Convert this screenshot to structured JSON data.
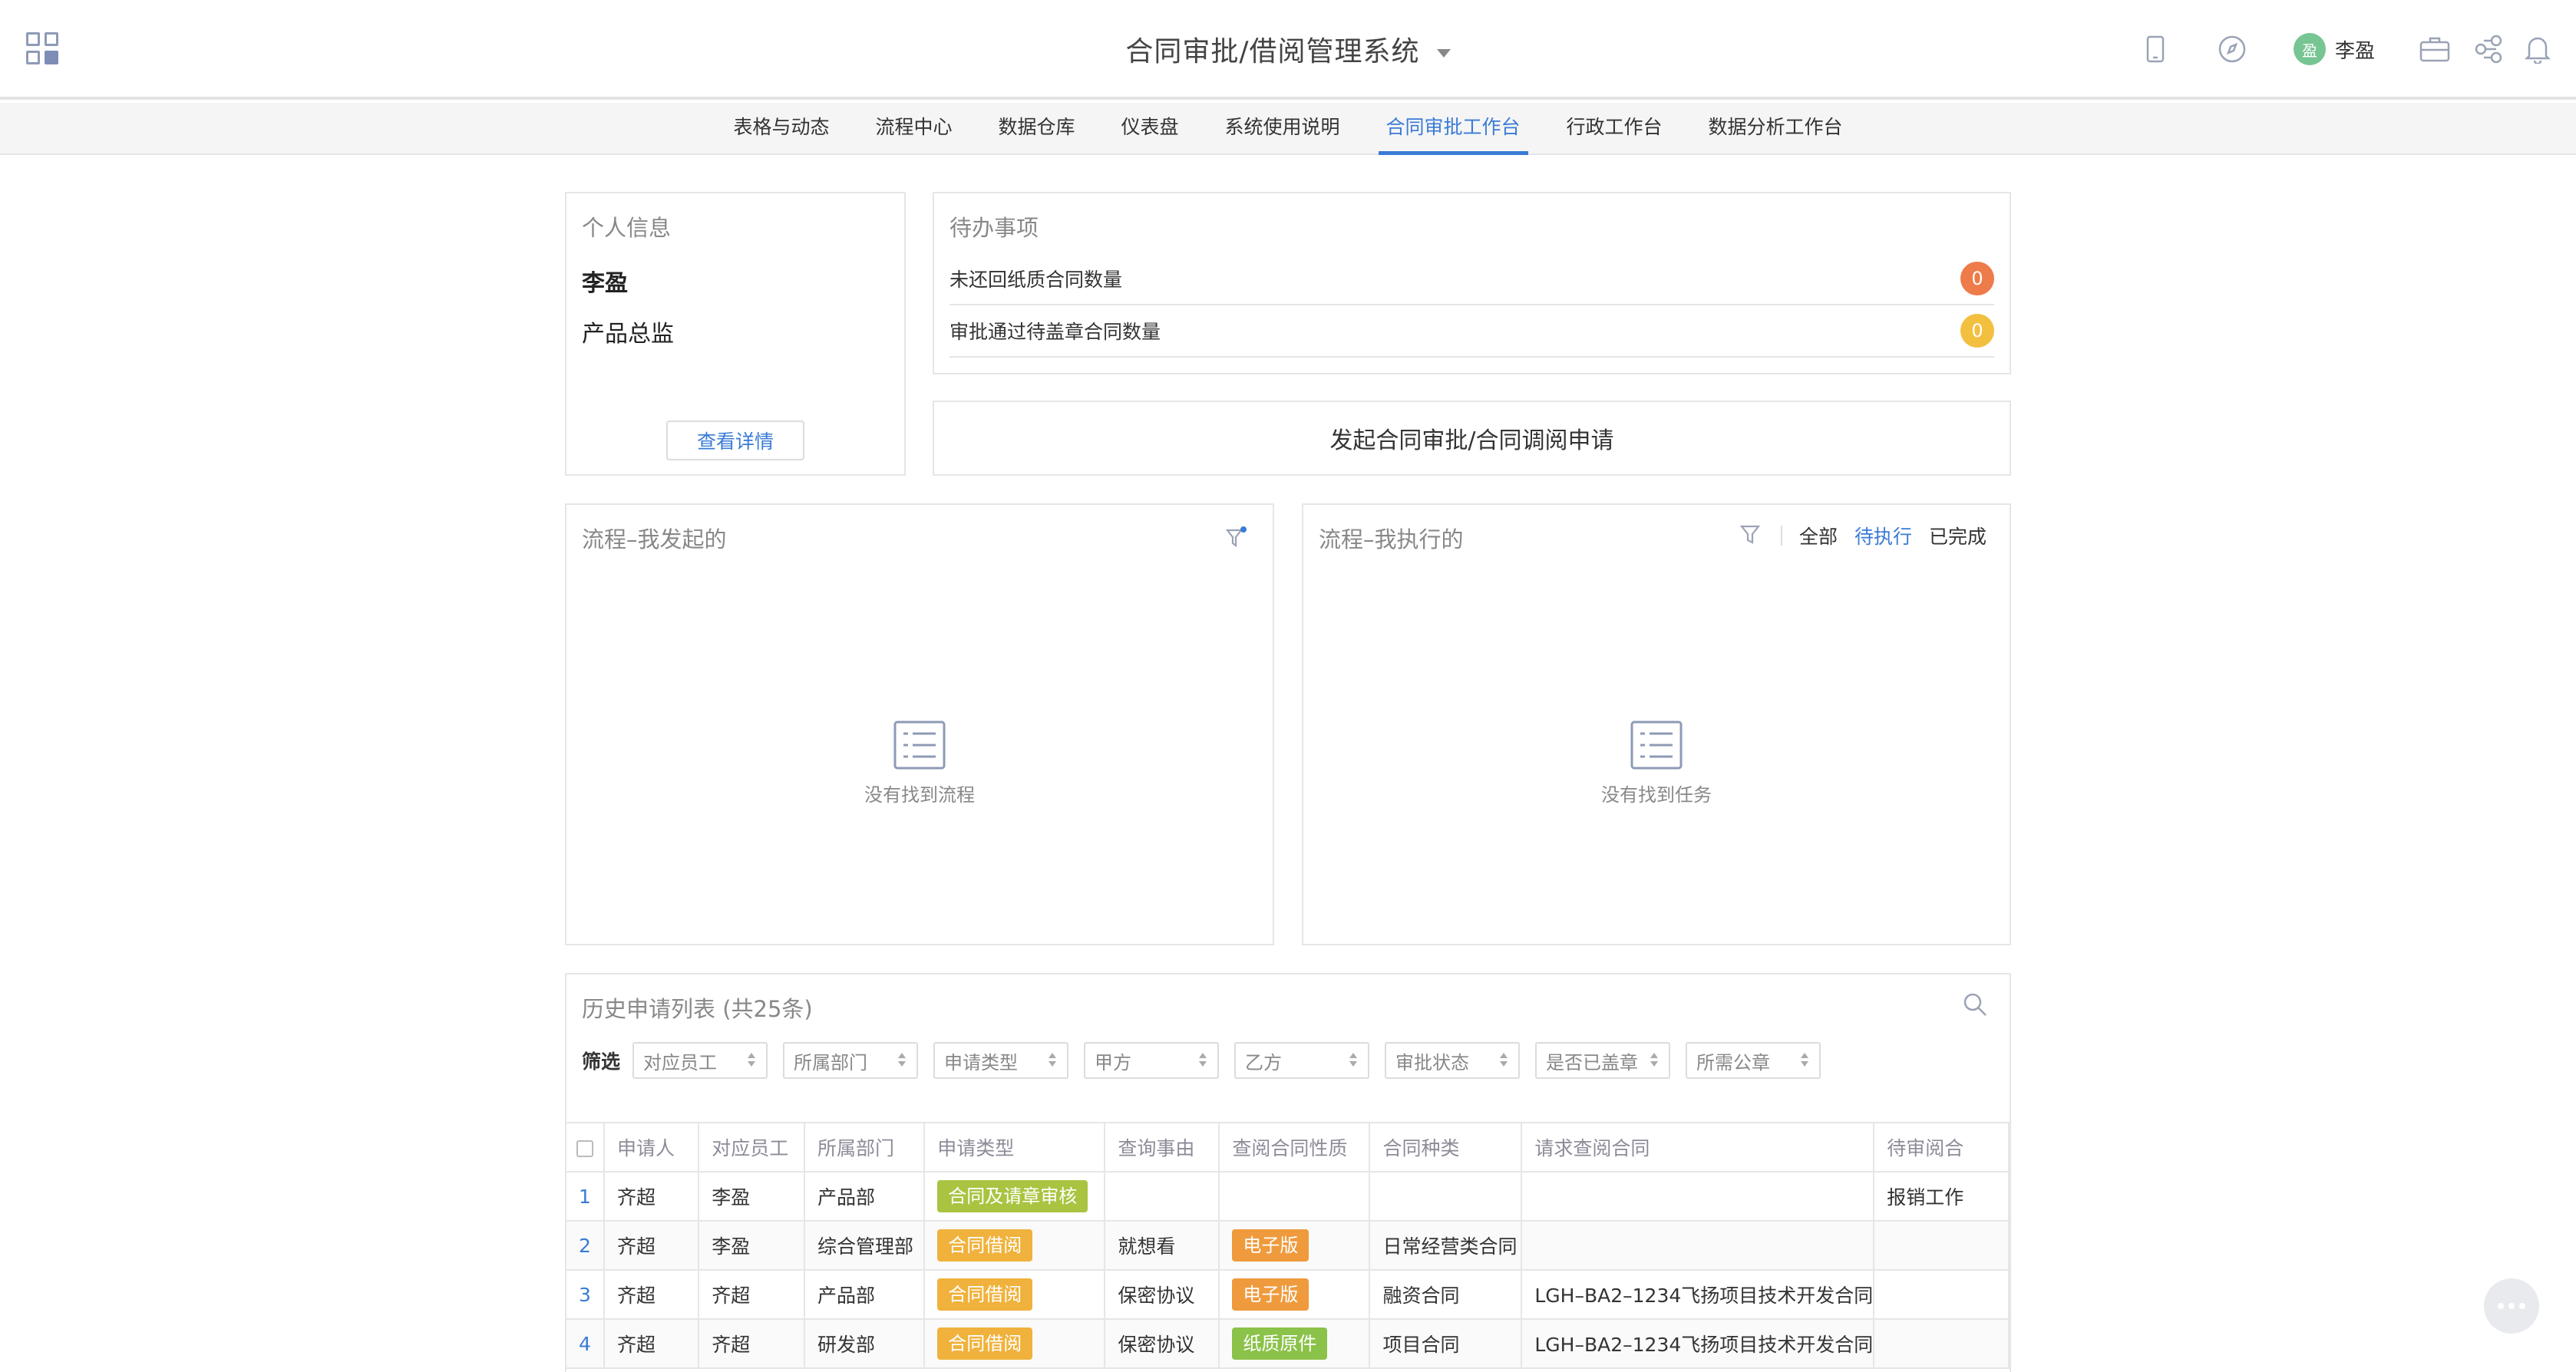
{
  "header": {
    "app_title": "合同审批/借阅管理系统",
    "user_name": "李盈",
    "user_avatar_char": "盈"
  },
  "nav": {
    "items": [
      {
        "label": "表格与动态"
      },
      {
        "label": "流程中心"
      },
      {
        "label": "数据仓库"
      },
      {
        "label": "仪表盘"
      },
      {
        "label": "系统使用说明"
      },
      {
        "label": "合同审批工作台",
        "active": true
      },
      {
        "label": "行政工作台"
      },
      {
        "label": "数据分析工作台"
      }
    ]
  },
  "personal": {
    "title": "个人信息",
    "name": "李盈",
    "role": "产品总监",
    "detail_button": "查看详情"
  },
  "todo": {
    "title": "待办事项",
    "items": [
      {
        "label": "未还回纸质合同数量",
        "count": "0",
        "color": "#ee7b4a"
      },
      {
        "label": "审批通过待盖章合同数量",
        "count": "0",
        "color": "#f3bf3f"
      }
    ]
  },
  "start_request_button": "发起合同审批/合同调阅申请",
  "flow_started": {
    "title": "流程–我发起的",
    "empty_text": "没有找到流程"
  },
  "flow_executed": {
    "title": "流程–我执行的",
    "tabs": [
      "全部",
      "待执行",
      "已完成"
    ],
    "active_tab": "待执行",
    "empty_text": "没有找到任务"
  },
  "history": {
    "title": "历史申请列表 (共25条)",
    "filter_label": "筛选",
    "filters": [
      "对应员工",
      "所属部门",
      "申请类型",
      "甲方",
      "乙方",
      "审批状态",
      "是否已盖章",
      "所需公章"
    ],
    "columns": [
      "申请人",
      "对应员工",
      "所属部门",
      "申请类型",
      "查询事由",
      "查阅合同性质",
      "合同种类",
      "请求查阅合同",
      "待审阅合"
    ],
    "rows": [
      {
        "idx": "1",
        "applicant": "齐超",
        "employee": "李盈",
        "dept": "产品部",
        "type": "合同及请章审核",
        "type_color": "green",
        "reason": "",
        "nature": "",
        "nature_color": "",
        "kind": "",
        "contract": "",
        "pending": "报销工作"
      },
      {
        "idx": "2",
        "applicant": "齐超",
        "employee": "李盈",
        "dept": "综合管理部",
        "type": "合同借阅",
        "type_color": "orange",
        "reason": "就想看",
        "nature": "电子版",
        "nature_color": "dorange",
        "kind": "日常经营类合同",
        "contract": "",
        "pending": ""
      },
      {
        "idx": "3",
        "applicant": "齐超",
        "employee": "齐超",
        "dept": "产品部",
        "type": "合同借阅",
        "type_color": "orange",
        "reason": "保密协议",
        "nature": "电子版",
        "nature_color": "dorange",
        "kind": "融资合同",
        "contract": "LGH–BA2–1234飞扬项目技术开发合同",
        "pending": ""
      },
      {
        "idx": "4",
        "applicant": "齐超",
        "employee": "齐超",
        "dept": "研发部",
        "type": "合同借阅",
        "type_color": "orange",
        "reason": "保密协议",
        "nature": "纸质原件",
        "nature_color": "lgreen",
        "kind": "项目合同",
        "contract": "LGH–BA2–1234飞扬项目技术开发合同",
        "pending": ""
      }
    ]
  }
}
